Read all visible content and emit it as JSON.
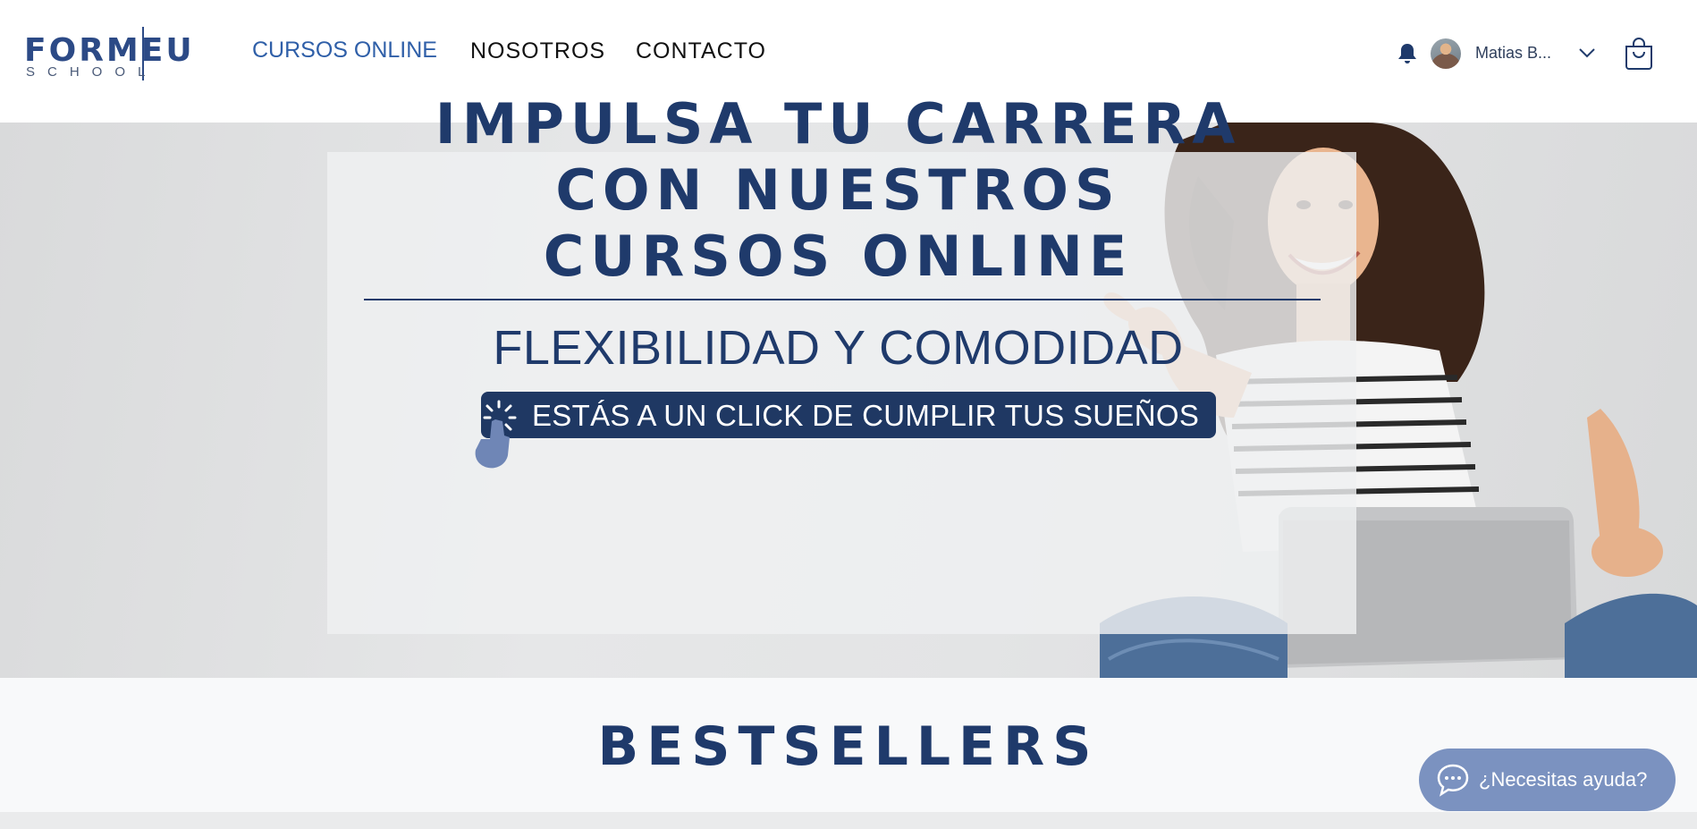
{
  "header": {
    "logo": {
      "word": "FORMEU",
      "sub": "SCHOOL"
    },
    "nav": [
      {
        "label": "CURSOS ONLINE",
        "active": true
      },
      {
        "label": "NOSOTROS"
      },
      {
        "label": "CONTACTO"
      }
    ],
    "user": {
      "name": "Matias B..."
    },
    "icons": {
      "notifications": "bell-icon",
      "menu": "chevron-down-icon",
      "cart": "cart-icon"
    }
  },
  "hero": {
    "headline_lines": [
      "IMPULSA TU CARRERA",
      "CON NUESTROS",
      "CURSOS ONLINE"
    ],
    "subheadline": "FLEXIBILIDAD Y COMODIDAD",
    "cta_label": "ESTÁS A UN CLICK DE CUMPLIR TUS SUEÑOS"
  },
  "section": {
    "title": "BESTSELLERS"
  },
  "chat": {
    "label": "¿Necesitas ayuda?",
    "icon": "chat-bubble-icon"
  },
  "colors": {
    "brand_navy": "#1f3a6b",
    "nav_active": "#2f5fa8",
    "chat_widget": "#7b92c0",
    "cta_background": "#1f3863"
  }
}
